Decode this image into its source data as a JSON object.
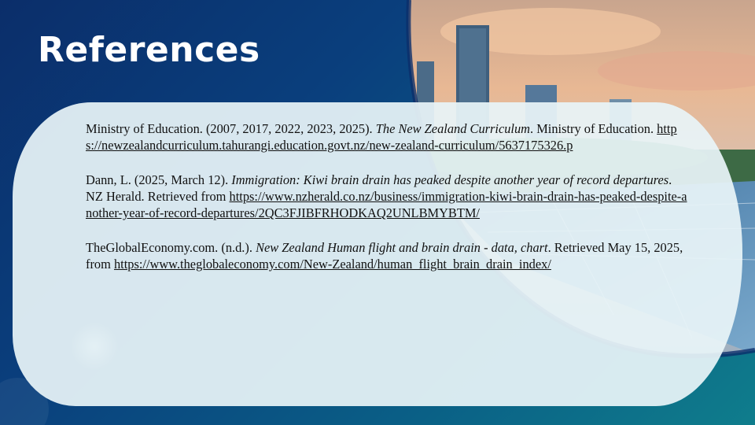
{
  "slide": {
    "title": "References",
    "colors": {
      "bg_dark": "#0b2e6a",
      "bg_teal": "#0f7d8c",
      "card": "#e8f4f7",
      "text": "#111111"
    }
  },
  "references": [
    {
      "lead": "Ministry of Education. (2007, 2017, 2022, 2023, 2025). ",
      "title": "The New Zealand Curriculum",
      "tail": ". Ministry of Education. ",
      "url": "https://newzealandcurriculum.tahurangi.education.govt.nz/new-zealand-curriculum/5637175326.p"
    },
    {
      "lead": "Dann, L. (2025, March 12). ",
      "title": "Immigration: Kiwi brain drain has peaked despite another year of record departures",
      "tail": ". NZ Herald. Retrieved from ",
      "url": "https://www.nzherald.co.nz/business/immigration-kiwi-brain-drain-has-peaked-despite-another-year-of-record-departures/2QC3FJIBFRHODKAQ2UNLBMYBTM/"
    },
    {
      "lead": "TheGlobalEconomy.com. (n.d.). ",
      "title": "New Zealand Human flight and brain drain - data, chart",
      "tail": ". Retrieved May 15, 2025, from ",
      "url": "https://www.theglobaleconomy.com/New-Zealand/human_flight_brain_drain_index/"
    }
  ]
}
